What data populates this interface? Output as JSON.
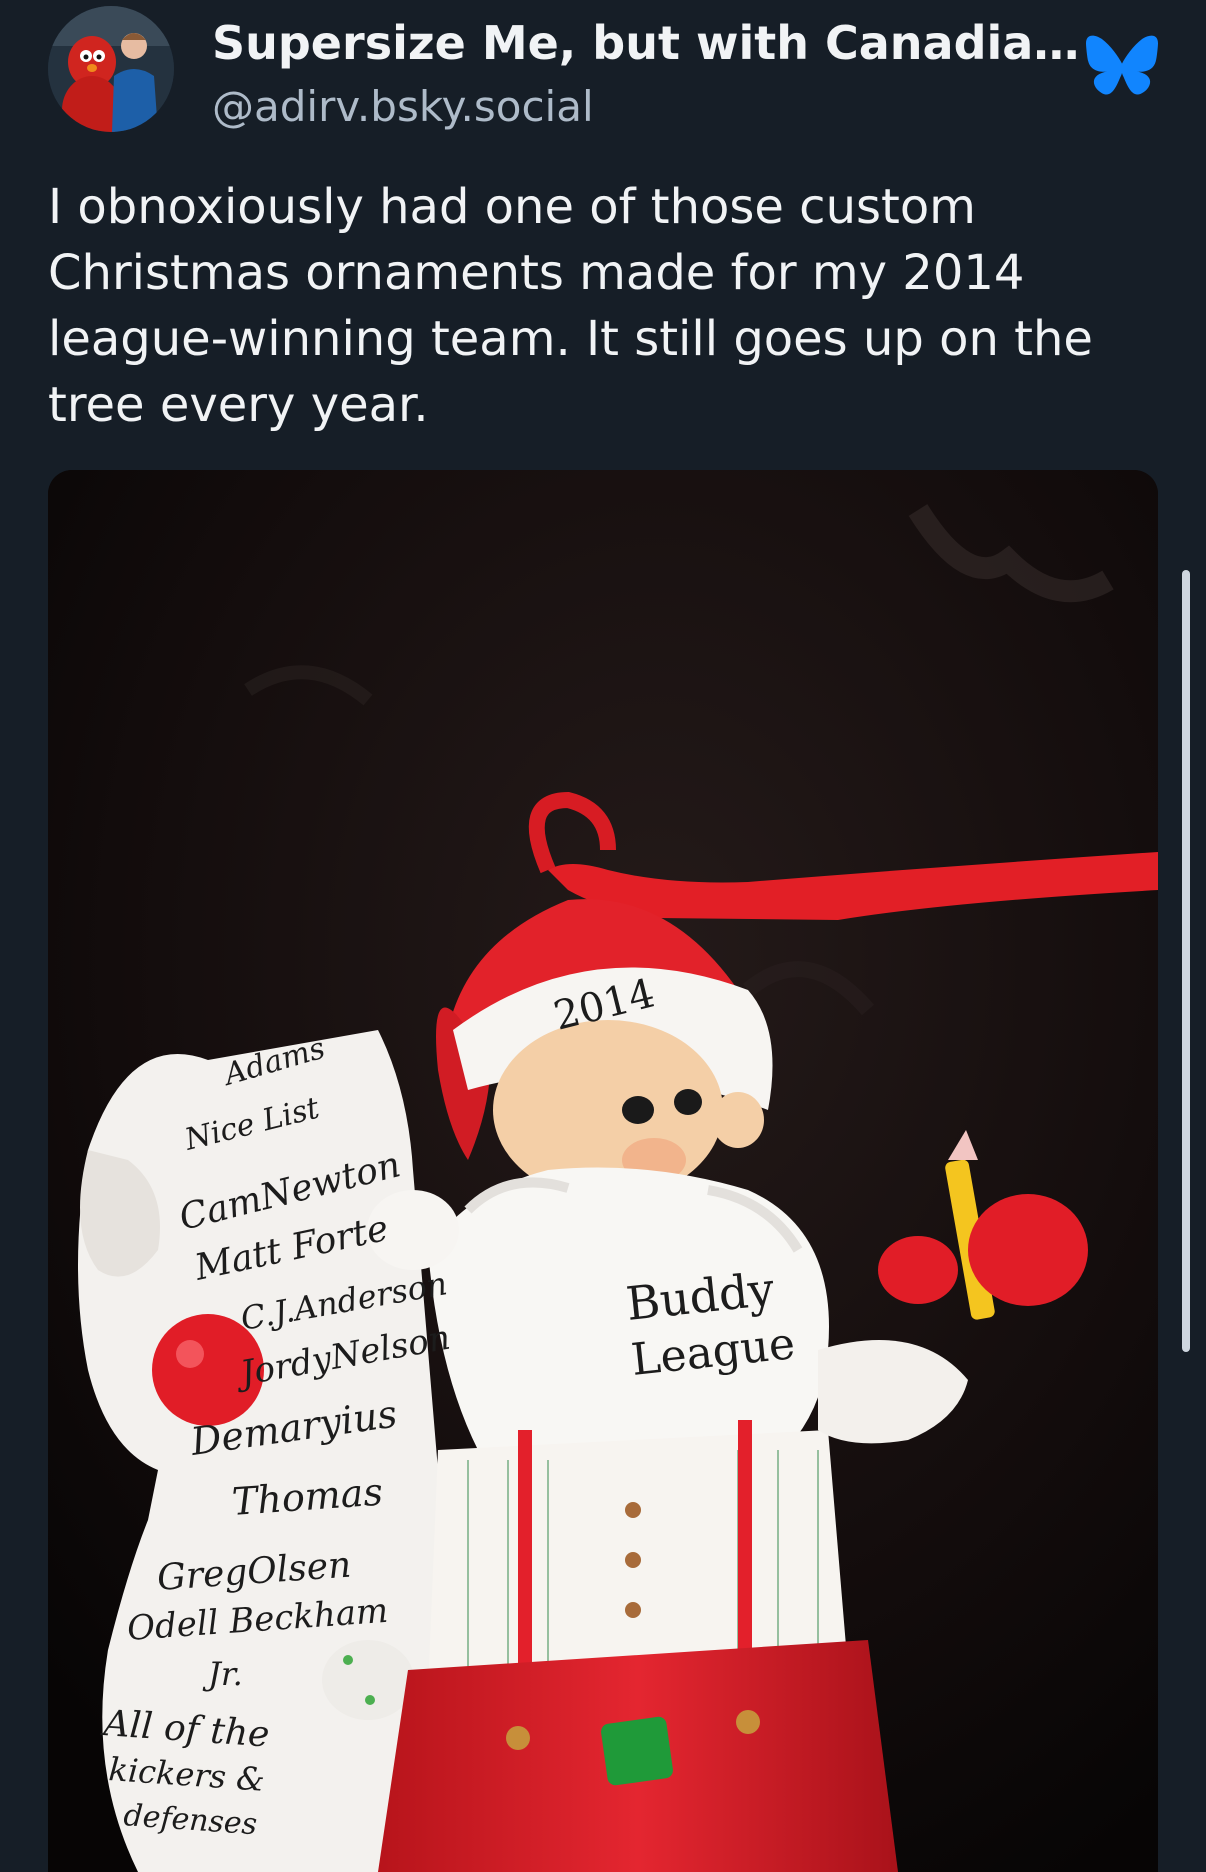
{
  "post": {
    "author": {
      "display_name": "Supersize Me, but with Canadia...",
      "handle": "@adirv.bsky.social"
    },
    "text": "I obnoxiously had one of those custom Christmas ornaments made for my 2014 league-winning team. It still goes up on the tree every year.",
    "platform_icon": "bluesky-butterfly-icon"
  },
  "photo": {
    "ornament_year": "2014",
    "belly_text_1": "Buddy",
    "belly_text_2": "League",
    "scroll_lines": [
      "Adams",
      "Nice List",
      "CamNewton",
      "Matt Forte",
      "C.J.Anderson",
      "JordyNelson",
      "Demaryius",
      "Thomas",
      "GregOlsen",
      "Odell Beckham",
      "Jr.",
      "All of the",
      "kickers &",
      "defenses"
    ]
  },
  "colors": {
    "background": "#161e27",
    "text_primary": "#f1f3f5",
    "text_secondary": "#aebbc9",
    "brand_blue": "#1185fe"
  }
}
